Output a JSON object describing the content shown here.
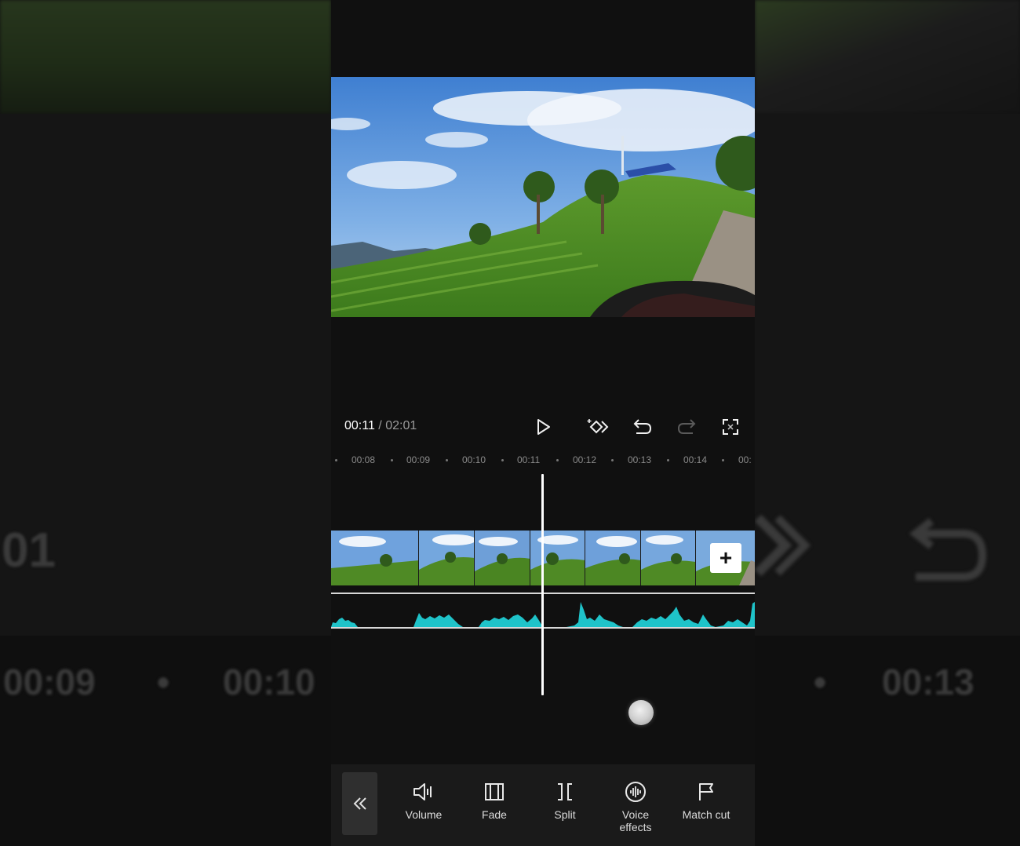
{
  "player": {
    "current_time": "00:11",
    "separator": " / ",
    "total_time": "02:01"
  },
  "ruler": {
    "ticks": [
      "00:08",
      "00:09",
      "00:10",
      "00:11",
      "00:12",
      "00:13",
      "00:14",
      "00:"
    ]
  },
  "icons": {
    "play": "play-icon",
    "keyframe": "keyframe-icon",
    "undo": "undo-icon",
    "redo": "redo-icon",
    "fullscreen": "fullscreen-icon",
    "add_clip": "plus-icon",
    "back": "double-chevron-left-icon"
  },
  "add_clip_label": "+",
  "toolbar": {
    "back_label": "«",
    "items": [
      {
        "label": "Volume",
        "icon": "volume-icon"
      },
      {
        "label": "Fade",
        "icon": "fade-icon"
      },
      {
        "label": "Split",
        "icon": "split-icon"
      },
      {
        "label": "Voice effects",
        "icon": "voice-effects-icon"
      },
      {
        "label": "Match cut",
        "icon": "match-cut-icon"
      }
    ]
  },
  "background_ghosts": {
    "left_time_fragment": "01",
    "left_tick_1": "00:09",
    "left_tick_2": "00:10",
    "right_tick": "00:13"
  },
  "colors": {
    "audio_waveform": "#1fc3c9",
    "playhead": "#ffffff",
    "toolbar_bg": "#1a1a1a",
    "app_bg": "#101010"
  }
}
